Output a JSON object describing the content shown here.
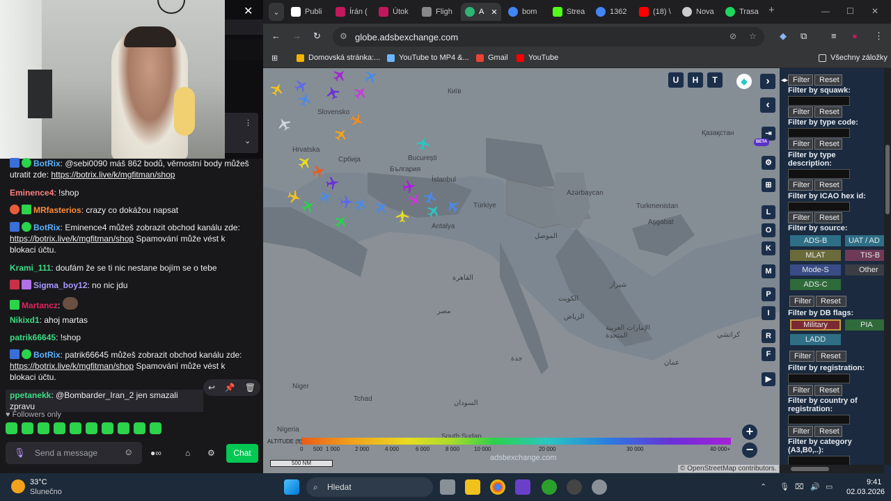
{
  "chat": {
    "messages": [
      {
        "user": "BotRix",
        "color": "#5db3ff",
        "text": ": @sebi0090 máš 862 bodů, věrnostní body můžeš utratit zde: ",
        "link": "https://botrix.live/k/mgfitman/shop",
        "after": ""
      },
      {
        "user": "Eminence4",
        "color": "#ff7f7f",
        "text": ": !shop"
      },
      {
        "user": "MRfasterios",
        "color": "#ff8c3a",
        "text": ": crazy co dokážou napsat"
      },
      {
        "user": "BotRix",
        "color": "#5db3ff",
        "text": ": Eminence4 můžeš zobrazit obchod kanálu zde: ",
        "link": "https://botrix.live/k/mgfitman/shop",
        "after": " Spamování může vést k blokaci účtu."
      },
      {
        "user": "Krami_111",
        "color": "#3ddc84",
        "text": ": doufám že se ti nic nestane bojím se o tebe"
      },
      {
        "user": "Sigma_boy12",
        "color": "#a89bff",
        "text": ": no nic jdu"
      },
      {
        "user": "Martancz",
        "color": "#e0245e",
        "text": ":"
      },
      {
        "user": "Nikixd1",
        "color": "#3ddc84",
        "text": ": ahoj martas"
      },
      {
        "user": "patrik66645",
        "color": "#3ddc84",
        "text": ": !shop"
      },
      {
        "user": "BotRix",
        "color": "#5db3ff",
        "text": ": patrik66645 můžeš zobrazit obchod kanálu zde: ",
        "link": "https://botrix.live/k/mgfitman/shop",
        "after": " Spamování může vést k blokaci účtu."
      },
      {
        "user": "ppetanekk",
        "color": "#3ddc84",
        "text": ": @Bombarder_Iran_2 jen smazali zpravu"
      }
    ],
    "followers_only": "Followers only",
    "send_placeholder": "Send a message",
    "chat_button": "Chat"
  },
  "browser": {
    "tabs": [
      {
        "label": "Publi",
        "color": "#ffffff"
      },
      {
        "label": "Írán (",
        "color": "#c2185b"
      },
      {
        "label": "Útok",
        "color": "#c2185b"
      },
      {
        "label": "Fligh",
        "color": "#888888"
      },
      {
        "label": "A",
        "color": "#2bb673",
        "active": true
      },
      {
        "label": "bom",
        "color": "#4285f4"
      },
      {
        "label": "Strea",
        "color": "#53fc18"
      },
      {
        "label": "1362",
        "color": "#4285f4"
      },
      {
        "label": "(18) \\",
        "color": "#ff0000"
      },
      {
        "label": "Nova",
        "color": "#cccccc"
      },
      {
        "label": "Trasa",
        "color": "#1ed760"
      }
    ],
    "url": "globe.adsbexchange.com",
    "bookmarks": [
      {
        "label": "Domovská stránka:...",
        "color": "#f4b400"
      },
      {
        "label": "YouTube to MP4 &...",
        "color": "#6ab7ff"
      },
      {
        "label": "Gmail",
        "color": "#ea4335"
      },
      {
        "label": "YouTube",
        "color": "#ff0000"
      }
    ],
    "all_bookmarks": "Všechny záložky"
  },
  "map": {
    "places": [
      {
        "t": "Київ"
      },
      {
        "t": "Slovensko"
      },
      {
        "t": "Hrvatska"
      },
      {
        "t": "Србија"
      },
      {
        "t": "București"
      },
      {
        "t": "България"
      },
      {
        "t": "İstanbul"
      },
      {
        "t": "Türkiye"
      },
      {
        "t": "Azərbaycan"
      },
      {
        "t": "Turkmenistan"
      },
      {
        "t": "Aşgabat"
      },
      {
        "t": "Қазақстан"
      },
      {
        "t": "Antalya"
      },
      {
        "t": "الموصل"
      },
      {
        "t": "القاهرة"
      },
      {
        "t": "مصر"
      },
      {
        "t": "الكويت"
      },
      {
        "t": "شيراز"
      },
      {
        "t": "الرياض"
      },
      {
        "t": "الإمارات العربية المتحدة"
      },
      {
        "t": "Niger"
      },
      {
        "t": "Tchad"
      },
      {
        "t": "السودان"
      },
      {
        "t": "South Sudan"
      },
      {
        "t": "Nigeria"
      },
      {
        "t": "عمان"
      },
      {
        "t": "جدة"
      },
      {
        "t": "كراتشي"
      }
    ],
    "side_buttons": [
      "L",
      "O",
      "K",
      "M",
      "P",
      "I",
      "R",
      "F"
    ],
    "top_buttons": [
      "U",
      "H",
      "T"
    ],
    "altitude_label": "ALTITUDE (ft)",
    "altitude_ticks": [
      "0",
      "500",
      "1 000",
      "2 000",
      "4 000",
      "6 000",
      "8 000",
      "10 000",
      "20 000",
      "30 000",
      "40 000+"
    ],
    "scale": "500 NM",
    "watermark": "adsbexchange.com",
    "attribution": "© OpenStreetMap contributors."
  },
  "filters": {
    "labels": [
      "Filter by squawk:",
      "Filter by type code:",
      "Filter by type description:",
      "Filter by ICAO hex id:",
      "Filter by source:",
      "Filter by DB flags:",
      "Filter by registration:",
      "Filter by country of registration:",
      "Filter by category (A3,B0,..):"
    ],
    "filter_btn": "Filter",
    "reset_btn": "Reset",
    "sources": [
      "ADS-B",
      "UAT / AD",
      "MLAT",
      "TIS-B",
      "Mode-S",
      "Other",
      "ADS-C"
    ],
    "flags": [
      "Military",
      "PIA",
      "LADD"
    ],
    "beta": "BETA"
  },
  "taskbar": {
    "weather_temp": "33°C",
    "weather_desc": "Slunečno",
    "search": "Hledat",
    "time": "9:41",
    "date": "02.03.2026"
  }
}
